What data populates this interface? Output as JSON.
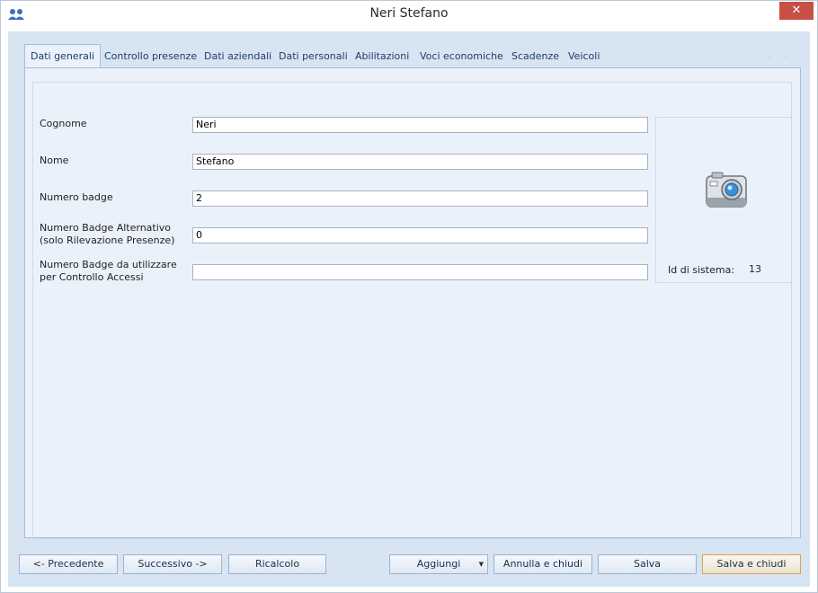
{
  "window": {
    "title": "Neri Stefano",
    "close_glyph": "✕"
  },
  "tabs": [
    {
      "label": "Dati generali",
      "active": true
    },
    {
      "label": "Controllo presenze",
      "active": false
    },
    {
      "label": "Dati aziendali",
      "active": false
    },
    {
      "label": "Dati personali",
      "active": false
    },
    {
      "label": "Abilitazioni",
      "active": false
    },
    {
      "label": "Voci economiche",
      "active": false
    },
    {
      "label": "Scadenze",
      "active": false
    },
    {
      "label": "Veicoli",
      "active": false
    }
  ],
  "tab_scroll": {
    "left": "‹",
    "right": "›"
  },
  "form": {
    "cognome": {
      "label": "Cognome",
      "value": "Neri"
    },
    "nome": {
      "label": "Nome",
      "value": "Stefano"
    },
    "badge": {
      "label": "Numero badge",
      "value": "2"
    },
    "badge_alt": {
      "label_line1": "Numero Badge Alternativo",
      "label_line2": "(solo Rilevazione Presenze)",
      "value": "0"
    },
    "badge_accessi": {
      "label_line1": "Numero Badge da utilizzare",
      "label_line2": "per Controllo Accessi",
      "value": ""
    }
  },
  "photo": {
    "icon": "camera-icon",
    "sysid_label": "Id di sistema:",
    "sysid_value": "13"
  },
  "buttons": {
    "prev": "<- Precedente",
    "next": "Successivo ->",
    "recalc": "Ricalcolo",
    "add": "Aggiungi",
    "cancel_close": "Annulla e chiudi",
    "save": "Salva",
    "save_close": "Salva e chiudi"
  },
  "colors": {
    "accent": "#1e3d6b",
    "close": "#c74f45",
    "panel": "#ebf1fb",
    "background": "#d7e4f2"
  }
}
